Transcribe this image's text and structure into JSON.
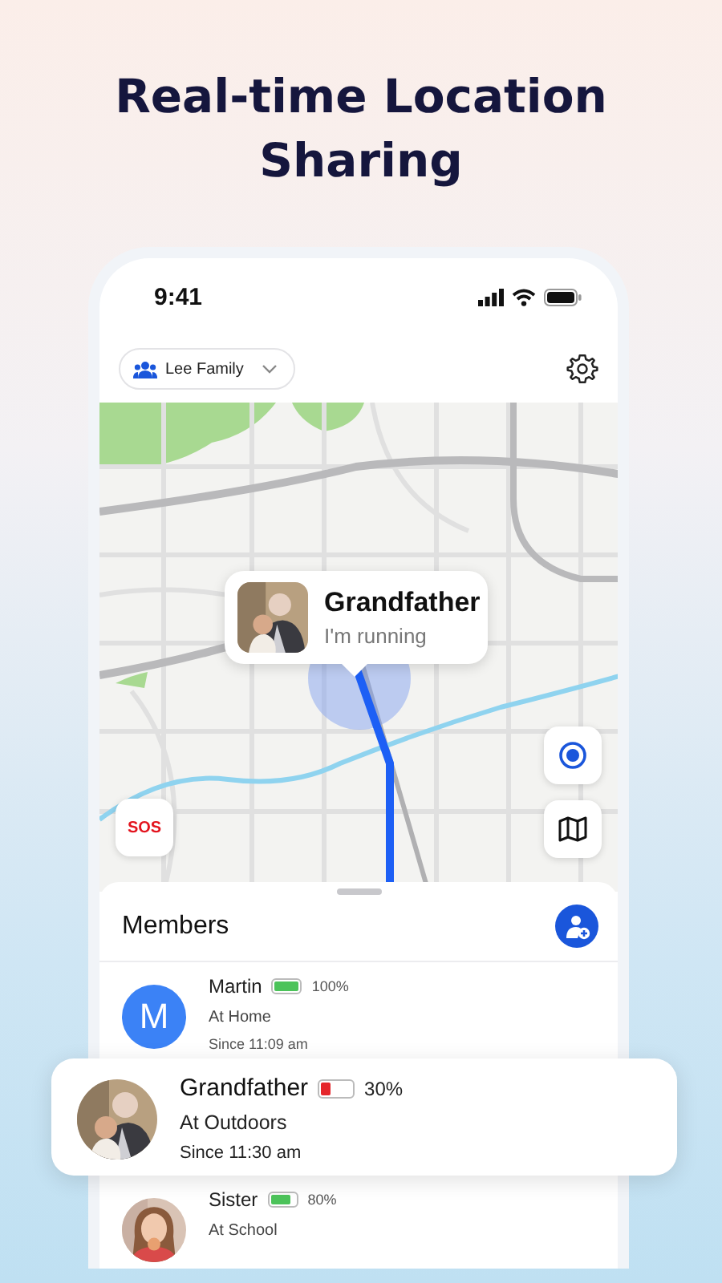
{
  "headline": "Real-time Location Sharing",
  "status_bar": {
    "time": "9:41"
  },
  "group_selector": {
    "label": "Lee Family"
  },
  "map": {
    "kind": "picture",
    "callout": {
      "name": "Grandfather",
      "status": "I'm running"
    },
    "sos_button": {
      "label": "SOS"
    }
  },
  "members": {
    "title": "Members",
    "items": [
      {
        "name": "Martin",
        "avatar": {
          "kind": "initial",
          "initial": "M"
        },
        "battery": "100%",
        "level": 1.0,
        "place": "At Home",
        "since": "Since 11:09 am",
        "highlighted": false
      },
      {
        "name": "Grandfather",
        "battery": "30%",
        "level": 0.3,
        "place": "At Outdoors",
        "since": "Since 11:30 am",
        "highlighted": true
      },
      {
        "name": "Sister",
        "battery": "80%",
        "level": 0.8,
        "place": "At School",
        "highlighted": false
      }
    ]
  }
}
